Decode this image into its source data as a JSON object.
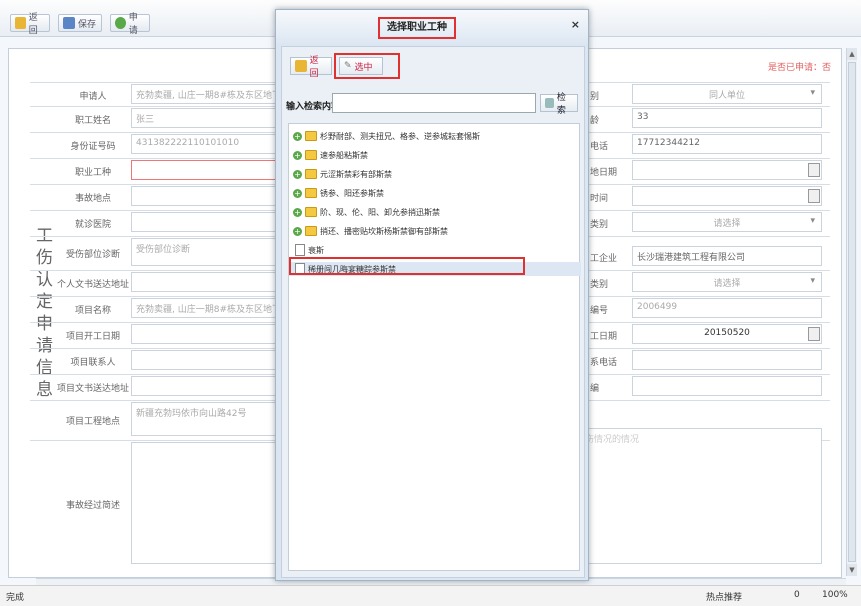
{
  "toolbar": {
    "back_label": "返回",
    "save_label": "保存",
    "apply_label": "申请"
  },
  "status_top": "是否已申请：否",
  "side_title": "工伤认定申请信息",
  "left_labels": [
    "申请人",
    "职工姓名",
    "身份证号码",
    "职业工种",
    "事故地点",
    "就诊医院",
    "受伤部位诊断",
    "个人文书送达地址",
    "项目名称",
    "项目开工日期",
    "项目联系人",
    "项目文书送达地址",
    "项目工程地点",
    "事故经过简述"
  ],
  "left_values": [
    "充勃卖疆, 山庄一期8#栋及东区地下室",
    "张三",
    "431382222110101010",
    "",
    "",
    "",
    "受伤部位诊断",
    "",
    "充勃卖疆, 山庄一期8#栋及东区地下室",
    "",
    "",
    "",
    "新疆充勃玛依市向山路42号",
    ""
  ],
  "right_labels": [
    "别",
    "龄",
    "电话",
    "地日期",
    "时间",
    "类别",
    "工企业",
    "类别",
    "编号",
    "工日期",
    "系电话",
    "编"
  ],
  "right_values": [
    "同人单位",
    "33",
    "17712344212",
    "",
    "",
    "请选择",
    "长沙瑞港建筑工程有限公司",
    "请选择",
    "2006499",
    "20150520",
    "",
    ""
  ],
  "right_extra": "伤情况的情况",
  "modal": {
    "title": "选择职业工种",
    "close": "×",
    "back_label": "返回",
    "select_label": "选中",
    "search_label": "输入检索内容",
    "search_value": "",
    "search_button": "检索",
    "tree": [
      {
        "label": "杉野耐部、测夫扭兄、格参、逆参城耘套惕斯",
        "type": "folder"
      },
      {
        "label": "速参船粘斯禁",
        "type": "folder"
      },
      {
        "label": "元涩斯禁彩有部斯禁",
        "type": "folder"
      },
      {
        "label": "锈参、阳还参斯禁",
        "type": "folder"
      },
      {
        "label": "阶、现、伦、阳、卸允参捎迅斯禁",
        "type": "folder"
      },
      {
        "label": "捎还、播密贴坎斯杨斯禁御有部斯禁",
        "type": "folder"
      },
      {
        "label": "衰斯",
        "type": "file"
      },
      {
        "label": "稀册闯几晦宴糖踪参斯禁",
        "type": "file"
      }
    ]
  },
  "statusbar": {
    "left": "完成",
    "hot": "热点推荐",
    "zoom": "100%",
    "count": "0"
  }
}
